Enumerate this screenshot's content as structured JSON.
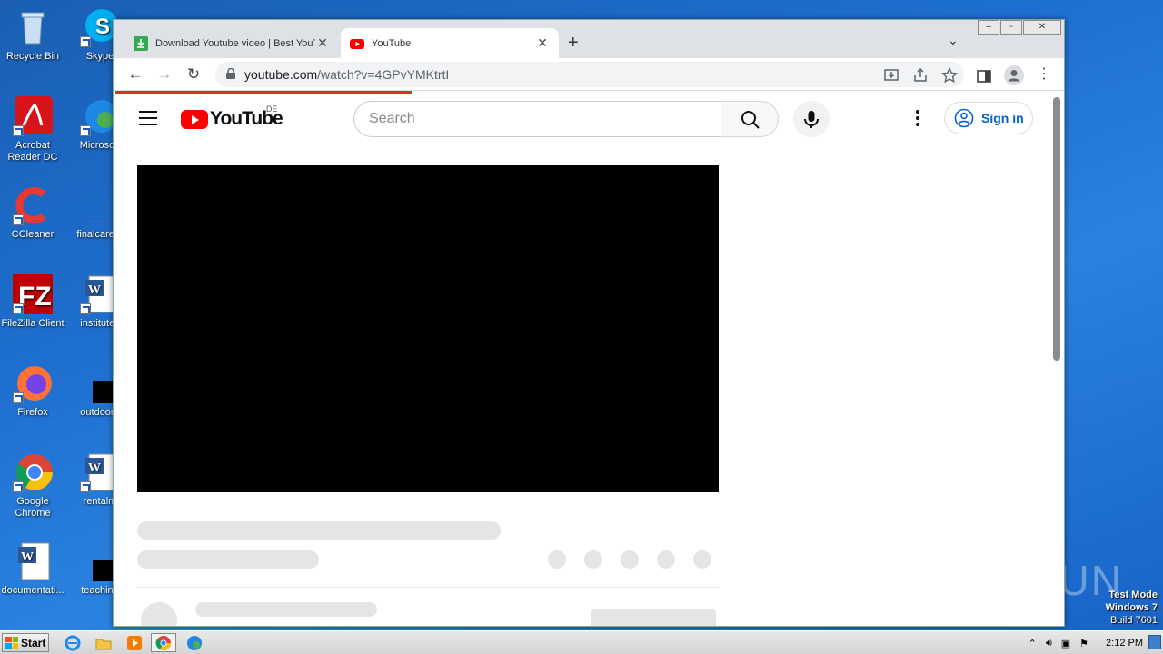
{
  "desktop": {
    "icons": [
      {
        "label": "Recycle Bin",
        "icon": "recycle-bin-icon"
      },
      {
        "label": "Skype",
        "icon": "skype-icon"
      },
      {
        "label": "Acrobat Reader DC",
        "icon": "acrobat-icon"
      },
      {
        "label": "Microsoft",
        "icon": "edge-icon"
      },
      {
        "label": "CCleaner",
        "icon": "ccleaner-icon"
      },
      {
        "label": "finalcareer",
        "icon": "file-icon"
      },
      {
        "label": "FileZilla Client",
        "icon": "filezilla-icon"
      },
      {
        "label": "institutek",
        "icon": "word-doc-icon"
      },
      {
        "label": "Firefox",
        "icon": "firefox-icon"
      },
      {
        "label": "outdoord",
        "icon": "black-file-icon"
      },
      {
        "label": "Google Chrome",
        "icon": "chrome-icon"
      },
      {
        "label": "rentalm",
        "icon": "word-doc-icon"
      },
      {
        "label": "documentati...",
        "icon": "word-doc-icon"
      },
      {
        "label": "teaching",
        "icon": "black-file-icon"
      }
    ],
    "watermark": "ANY RUN",
    "test_mode": {
      "line1": "Test Mode",
      "line2": "Windows 7",
      "line3": "Build 7601"
    }
  },
  "browser": {
    "tabs": [
      {
        "title": "Download Youtube video | Best YouTu",
        "active": false
      },
      {
        "title": "YouTube",
        "active": true
      }
    ],
    "new_tab": "+",
    "url": {
      "host": "youtube.com",
      "path": "/watch?v=4GPvYMKtrtI"
    }
  },
  "youtube": {
    "logo_text": "YouTube",
    "region": "DE",
    "search_placeholder": "Search",
    "sign_in": "Sign in"
  },
  "taskbar": {
    "start": "Start",
    "clock": "2:12 PM"
  },
  "colors": {
    "yt_red": "#ff0000",
    "signin_blue": "#065fd4",
    "load_bar": "#d93025"
  }
}
